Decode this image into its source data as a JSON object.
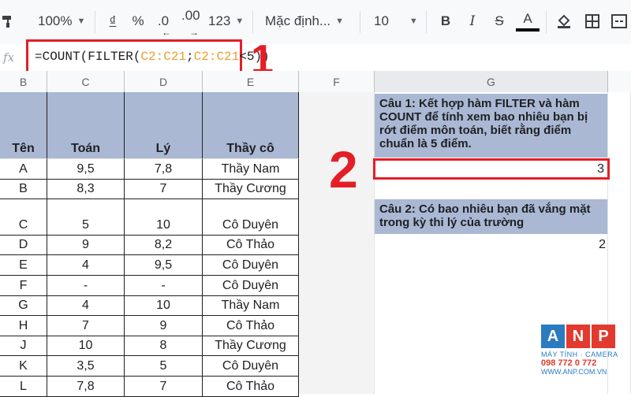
{
  "toolbar": {
    "zoom": "100%",
    "currency": "₫",
    "percent": "%",
    "dec_decrease": ".0",
    "dec_increase": ".00",
    "more_formats": "123",
    "font": "Mặc định...",
    "font_size": "10",
    "bold": "B",
    "italic": "I",
    "strike": "S",
    "text_color": "A"
  },
  "formula_bar": {
    "fx_label": "fx",
    "formula_prefix": "=COUNT(FILTER(",
    "ref1": "C2:C21",
    "sep": ";",
    "ref2": "C2:C21",
    "formula_suffix": "<5))"
  },
  "annotations": {
    "one": "1",
    "two": "2"
  },
  "columns": [
    "B",
    "C",
    "D",
    "E",
    "F",
    "G"
  ],
  "table": {
    "headers": [
      "Tên",
      "Toán",
      "Lý",
      "Thầy cô"
    ],
    "rows": [
      [
        "A",
        "9,5",
        "7,8",
        "Thầy Nam"
      ],
      [
        "B",
        "8,3",
        "7",
        "Thầy Cương"
      ],
      [
        "C",
        "5",
        "10",
        "Cô Duyên"
      ],
      [
        "D",
        "9",
        "8,2",
        "Cô Thảo"
      ],
      [
        "E",
        "4",
        "9,5",
        "Cô Duyên"
      ],
      [
        "F",
        "-",
        "-",
        "Cô Duyên"
      ],
      [
        "G",
        "4",
        "10",
        "Thầy Nam"
      ],
      [
        "H",
        "7",
        "9",
        "Cô Thảo"
      ],
      [
        "J",
        "10",
        "8",
        "Thầy Cương"
      ],
      [
        "K",
        "3,5",
        "5",
        "Cô Duyên"
      ],
      [
        "L",
        "7,8",
        "7",
        "Cô Thảo"
      ]
    ]
  },
  "questions": {
    "q1": "Câu 1: Kết hợp hàm FILTER và hàm COUNT để tính xem bao nhiêu bạn bị rớt điểm môn toán, biết rằng điểm chuẩn là 5 điểm.",
    "a1": "3",
    "q2": "Câu 2: Có bao nhiêu bạn đã vắng mặt trong kỳ thi lý của trường",
    "a2": "2"
  },
  "logo": {
    "letters": [
      "A",
      "N",
      "P"
    ],
    "line1": "MÁY TÍNH · CAMERA",
    "phone": "098 772 0 772",
    "site": "WWW.ANP.COM.VN"
  },
  "colors": {
    "accent_red": "#e41e26",
    "header_blue": "#aab8d4",
    "logo_blue": "#2b7bc0",
    "logo_red": "#e23a2e"
  }
}
